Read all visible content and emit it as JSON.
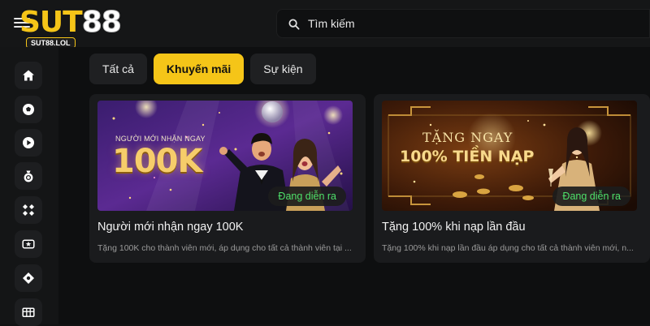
{
  "brand": {
    "logo_part1": "SUT",
    "logo_part2": "88",
    "url": "SUT88.LOL",
    "accent_color": "#f5c518"
  },
  "search": {
    "placeholder": "Tìm kiếm",
    "icon": "search-icon"
  },
  "sidebar": {
    "items": [
      {
        "icon": "home-icon"
      },
      {
        "icon": "soccer-ball-icon"
      },
      {
        "icon": "play-icon"
      },
      {
        "icon": "money-bag-icon"
      },
      {
        "icon": "games-grid-icon"
      },
      {
        "icon": "star-card-icon"
      },
      {
        "icon": "diamond-icon"
      },
      {
        "icon": "lottery-grid-icon"
      }
    ]
  },
  "tabs": [
    {
      "label": "Tất cả",
      "active": false
    },
    {
      "label": "Khuyến mãi",
      "active": true
    },
    {
      "label": "Sự kiện",
      "active": false
    }
  ],
  "promotions": [
    {
      "banner_subtitle": "NGƯỜI MỚI NHẬN NGAY",
      "banner_amount": "100K",
      "status": "Đang diễn ra",
      "title": "Người mới nhận ngay 100K",
      "description": "Tặng 100K cho thành viên mới, áp dụng cho tất cả thành viên tại ..."
    },
    {
      "banner_line1": "TẶNG NGAY",
      "banner_line2": "100% TIỀN NẠP",
      "status": "Đang diễn ra",
      "title": "Tặng 100% khi nạp lần đầu",
      "description": "Tặng 100% khi nạp lần đầu áp dụng cho tất cả thành viên mới, n..."
    }
  ]
}
